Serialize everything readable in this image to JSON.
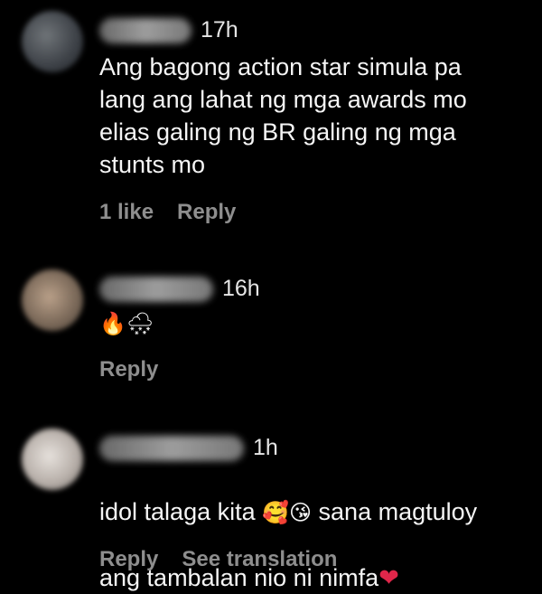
{
  "comments": [
    {
      "time": "17h",
      "text": "Ang bagong action star simula pa\nlang ang lahat ng mga awards mo\nelias galing ng BR galing ng mga\nstunts mo",
      "likes": "1 like",
      "reply": "Reply"
    },
    {
      "time": "16h",
      "emoji": "🔥🌨",
      "reply": "Reply"
    },
    {
      "time": "1h",
      "text_line1_a": "idol talaga kita ",
      "emoji_mid": "🥰😘",
      "text_line1_b": " sana magtuloy",
      "text_line2": "ang tambalan nio ni nimfa",
      "heart": "❤",
      "reply": "Reply",
      "see_translation": "See translation"
    }
  ],
  "colors": {
    "background": "#000000",
    "text": "#f5f5f5",
    "meta": "#8e8e8e",
    "heart": "#e0264a"
  }
}
